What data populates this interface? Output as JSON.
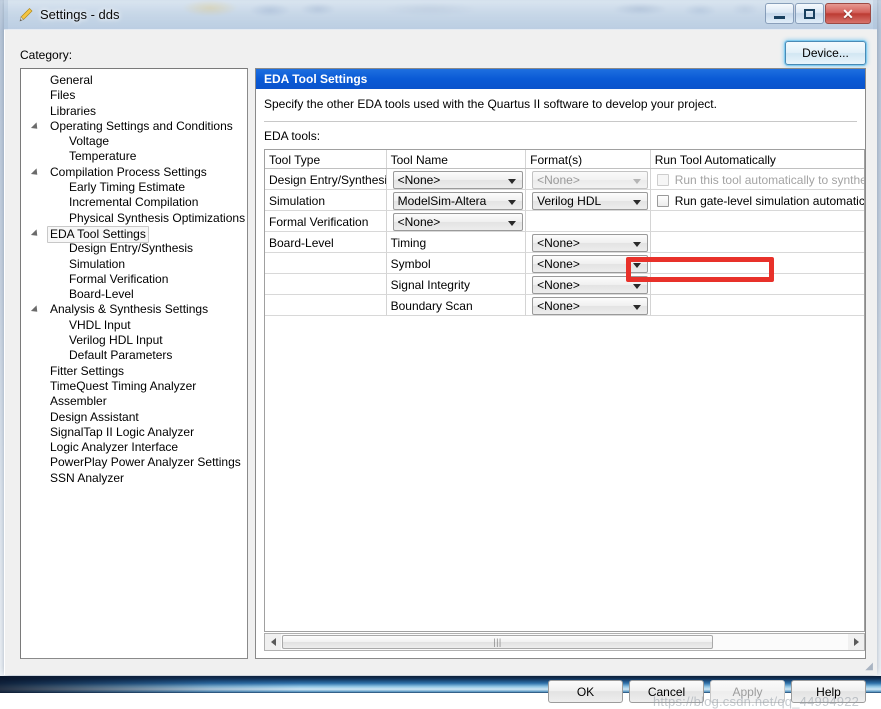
{
  "window": {
    "title": "Settings - dds",
    "icon": "pencil-icon",
    "buttons": {
      "minimize": "minimize",
      "maximize": "maximize",
      "close": "close"
    }
  },
  "left": {
    "category_label": "Category:",
    "tree": [
      {
        "label": "General",
        "level": 0,
        "expander": false,
        "selected": false
      },
      {
        "label": "Files",
        "level": 0,
        "expander": false,
        "selected": false
      },
      {
        "label": "Libraries",
        "level": 0,
        "expander": false,
        "selected": false
      },
      {
        "label": "Operating Settings and Conditions",
        "level": 0,
        "expander": true,
        "selected": false
      },
      {
        "label": "Voltage",
        "level": 1,
        "expander": false,
        "selected": false
      },
      {
        "label": "Temperature",
        "level": 1,
        "expander": false,
        "selected": false
      },
      {
        "label": "Compilation Process Settings",
        "level": 0,
        "expander": true,
        "selected": false
      },
      {
        "label": "Early Timing Estimate",
        "level": 1,
        "expander": false,
        "selected": false
      },
      {
        "label": "Incremental Compilation",
        "level": 1,
        "expander": false,
        "selected": false
      },
      {
        "label": "Physical Synthesis Optimizations",
        "level": 1,
        "expander": false,
        "selected": false
      },
      {
        "label": "EDA Tool Settings",
        "level": 0,
        "expander": true,
        "selected": true
      },
      {
        "label": "Design Entry/Synthesis",
        "level": 1,
        "expander": false,
        "selected": false
      },
      {
        "label": "Simulation",
        "level": 1,
        "expander": false,
        "selected": false
      },
      {
        "label": "Formal Verification",
        "level": 1,
        "expander": false,
        "selected": false
      },
      {
        "label": "Board-Level",
        "level": 1,
        "expander": false,
        "selected": false
      },
      {
        "label": "Analysis & Synthesis Settings",
        "level": 0,
        "expander": true,
        "selected": false
      },
      {
        "label": "VHDL Input",
        "level": 1,
        "expander": false,
        "selected": false
      },
      {
        "label": "Verilog HDL Input",
        "level": 1,
        "expander": false,
        "selected": false
      },
      {
        "label": "Default Parameters",
        "level": 1,
        "expander": false,
        "selected": false
      },
      {
        "label": "Fitter Settings",
        "level": 0,
        "expander": false,
        "selected": false
      },
      {
        "label": "TimeQuest Timing Analyzer",
        "level": 0,
        "expander": false,
        "selected": false
      },
      {
        "label": "Assembler",
        "level": 0,
        "expander": false,
        "selected": false
      },
      {
        "label": "Design Assistant",
        "level": 0,
        "expander": false,
        "selected": false
      },
      {
        "label": "SignalTap II Logic Analyzer",
        "level": 0,
        "expander": false,
        "selected": false
      },
      {
        "label": "Logic Analyzer Interface",
        "level": 0,
        "expander": false,
        "selected": false
      },
      {
        "label": "PowerPlay Power Analyzer Settings",
        "level": 0,
        "expander": false,
        "selected": false
      },
      {
        "label": "SSN Analyzer",
        "level": 0,
        "expander": false,
        "selected": false
      }
    ]
  },
  "toolbar": {
    "device_label": "Device..."
  },
  "main": {
    "header": "EDA Tool Settings",
    "description": "Specify the other EDA tools used with the Quartus II software to develop your project.",
    "eda_tools_label": "EDA tools:",
    "columns": [
      "Tool Type",
      "Tool Name",
      "Format(s)",
      "Run Tool Automatically"
    ],
    "rows": [
      {
        "tool_type": "Design Entry/Synthesis",
        "tool_name": {
          "kind": "combo",
          "value": "<None>",
          "disabled": false
        },
        "format": {
          "kind": "combo",
          "value": "<None>",
          "disabled": true
        },
        "run": {
          "kind": "checkbox",
          "label": "Run this tool automatically to synthesize the current design",
          "checked": false,
          "disabled": true
        }
      },
      {
        "tool_type": "Simulation",
        "tool_name": {
          "kind": "combo",
          "value": "ModelSim-Altera",
          "disabled": false,
          "highlight": true
        },
        "format": {
          "kind": "combo",
          "value": "Verilog HDL",
          "disabled": false
        },
        "run": {
          "kind": "checkbox",
          "label": "Run gate-level simulation automatically after compilation",
          "checked": false,
          "disabled": false
        }
      },
      {
        "tool_type": "Formal Verification",
        "tool_name": {
          "kind": "combo",
          "value": "<None>",
          "disabled": false
        },
        "format": {
          "kind": "empty"
        },
        "run": {
          "kind": "empty"
        }
      },
      {
        "tool_type": "Board-Level",
        "tool_name": {
          "kind": "text",
          "value": "Timing"
        },
        "format": {
          "kind": "combo",
          "value": "<None>",
          "disabled": false
        },
        "run": {
          "kind": "empty"
        }
      },
      {
        "tool_type": "",
        "tool_name": {
          "kind": "text",
          "value": "Symbol"
        },
        "format": {
          "kind": "combo",
          "value": "<None>",
          "disabled": false
        },
        "run": {
          "kind": "empty"
        }
      },
      {
        "tool_type": "",
        "tool_name": {
          "kind": "text",
          "value": "Signal Integrity"
        },
        "format": {
          "kind": "combo",
          "value": "<None>",
          "disabled": false
        },
        "run": {
          "kind": "empty"
        }
      },
      {
        "tool_type": "",
        "tool_name": {
          "kind": "text",
          "value": "Boundary Scan"
        },
        "format": {
          "kind": "combo",
          "value": "<None>",
          "disabled": false
        },
        "run": {
          "kind": "empty"
        }
      }
    ],
    "scrollbar": {
      "grip": "‖‖"
    }
  },
  "footer": {
    "ok": "OK",
    "cancel": "Cancel",
    "apply": "Apply",
    "apply_disabled": true,
    "help": "Help"
  },
  "watermark": "https://blog.csdn.net/qq_44994922",
  "colors": {
    "header_blue": "#0a5ad6",
    "highlight_red": "#e8312a",
    "close_red": "#bc3b33",
    "focus_blue": "#4a8ab5"
  }
}
